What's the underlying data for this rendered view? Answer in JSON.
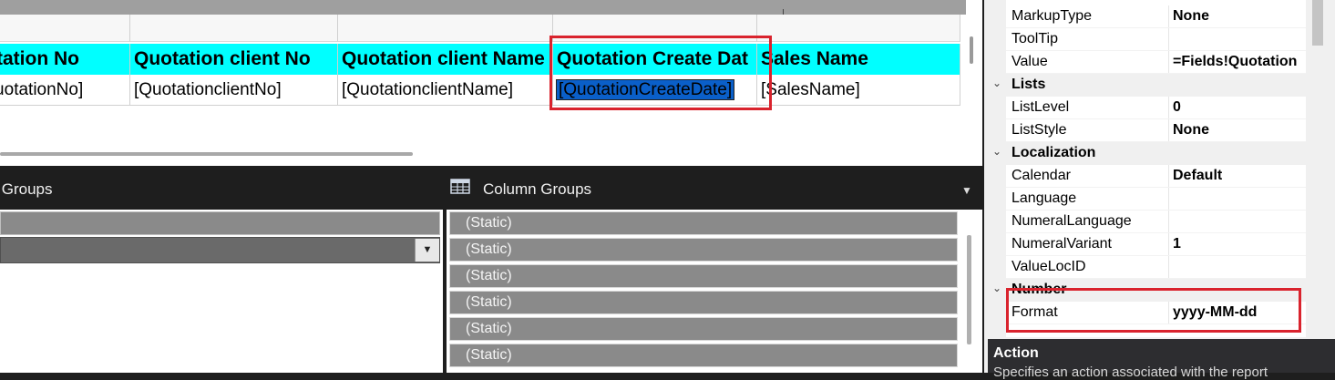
{
  "designer": {
    "columns": [
      {
        "header": "Quotation No",
        "field": "[QuotationNo]"
      },
      {
        "header": "Quotation client No",
        "field": "[QuotationclientNo]"
      },
      {
        "header": "Quotation client Name",
        "field": "[QuotationclientName]"
      },
      {
        "header": "Quotation Create Dat",
        "field": "[QuotationCreateDate]"
      },
      {
        "header": "Sales Name",
        "field": "[SalesName]"
      }
    ],
    "selected_column_index": 3,
    "header_bg": "#00ffff",
    "highlight_color": "#d9232d"
  },
  "grouping": {
    "row_groups_title": "Row Groups",
    "column_groups_title": "Column Groups",
    "column_groups_icon": "table-grid-icon",
    "column_items": [
      "(Static)",
      "(Static)",
      "(Static)",
      "(Static)",
      "(Static)",
      "(Static)"
    ]
  },
  "properties": {
    "rows": [
      {
        "type": "prop",
        "name": "MarkupType",
        "value": "None"
      },
      {
        "type": "prop",
        "name": "ToolTip",
        "value": ""
      },
      {
        "type": "prop",
        "name": "Value",
        "value": "=Fields!Quotation"
      },
      {
        "type": "cat",
        "name": "Lists"
      },
      {
        "type": "prop",
        "name": "ListLevel",
        "value": "0"
      },
      {
        "type": "prop",
        "name": "ListStyle",
        "value": "None"
      },
      {
        "type": "cat",
        "name": "Localization"
      },
      {
        "type": "prop",
        "name": "Calendar",
        "value": "Default"
      },
      {
        "type": "prop",
        "name": "Language",
        "value": ""
      },
      {
        "type": "prop",
        "name": "NumeralLanguage",
        "value": ""
      },
      {
        "type": "prop",
        "name": "NumeralVariant",
        "value": "1"
      },
      {
        "type": "prop",
        "name": "ValueLocID",
        "value": ""
      },
      {
        "type": "cat",
        "name": "Number"
      },
      {
        "type": "prop",
        "name": "Format",
        "value": "yyyy-MM-dd"
      }
    ],
    "description_title": "Action",
    "description_text": "Specifies an action associated with the report"
  }
}
